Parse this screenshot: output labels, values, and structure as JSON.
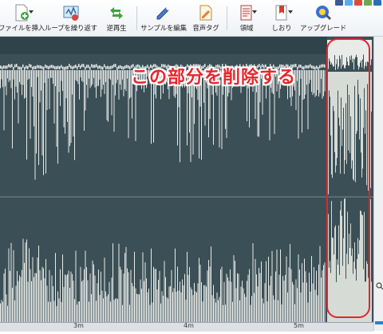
{
  "toolbar": {
    "insert_file": "ファイルを挿入",
    "loop_repeat": "ループを繰り返す",
    "reverse_play": "逆再生",
    "edit_sample": "サンプルを編集",
    "audio_tag": "音声タグ",
    "region": "領域",
    "bookmark": "しおり",
    "upgrade": "アップグレード"
  },
  "annotation": "この部分を削除する",
  "ruler": {
    "labels": [
      "3m",
      "4m",
      "5m"
    ]
  },
  "colors": {
    "waveform_bg": "#3b4f56",
    "waveform": "#e8ebe8",
    "annotation": "#e8262b",
    "selection_box": "#e0262c"
  }
}
